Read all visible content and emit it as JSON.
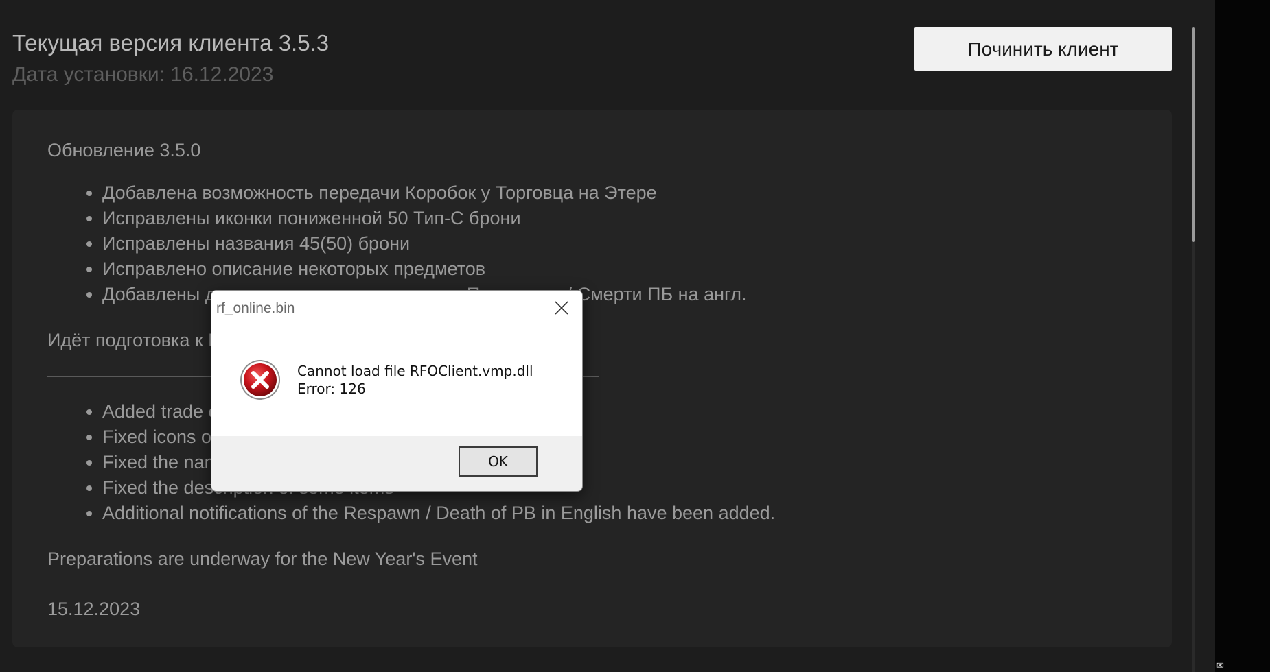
{
  "header": {
    "version_label": "Текущая версия клиента",
    "version": "3.5.3",
    "install_label": "Дата установки:",
    "install_date": "16.12.2023",
    "repair_button": "Починить клиент"
  },
  "news": {
    "heading": "Обновление 3.5.0",
    "items_ru": [
      "Добавлена возможность передачи Коробок у Торговца на Этере",
      "Исправлены иконки пониженной 50 Тип-С брони",
      "Исправлены названия 45(50) брони",
      "Исправлено описание некоторых предметов",
      "Добавлены дополнительные оповещения Появления / Смерти ПБ на англ."
    ],
    "note_ru": "Идёт подготовка к Новогоднему ивенту",
    "items_en": [
      "Added trade of boxes at the Ether Merchant",
      "Fixed icons of reduced 50 Type-C armor",
      "Fixed the names of 45(50) armor",
      "Fixed the description of some items",
      "Additional notifications of the Respawn / Death of PB in English have been added."
    ],
    "note_en": "Preparations are underway for the New Year's Event",
    "date": "15.12.2023"
  },
  "dialog": {
    "title": "rf_online.bin",
    "message_line1": "Cannot load file RFOClient.vmp.dll",
    "message_line2": "Error: 126",
    "ok_label": "OK"
  },
  "corner_glyph": "✉",
  "colors": {
    "background": "#1d1d1d",
    "panel": "#242424",
    "button": "#f1f1f1",
    "error_red": "#c8141c"
  }
}
